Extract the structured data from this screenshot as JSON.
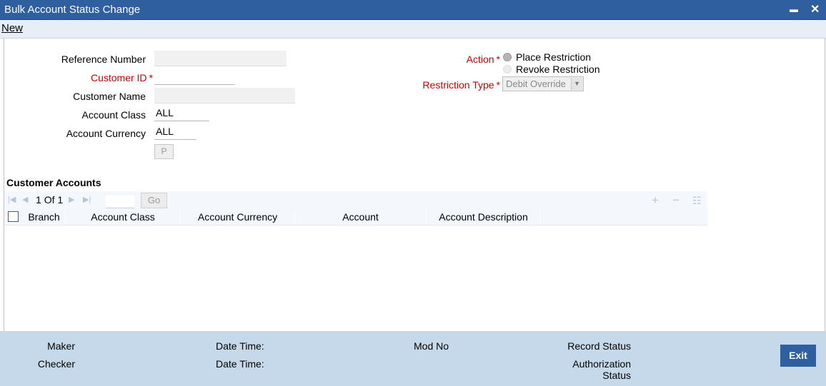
{
  "window": {
    "title": "Bulk Account Status Change",
    "minimize": "▬",
    "close": "✕"
  },
  "menu": {
    "new": "New"
  },
  "form": {
    "reference_number_label": "Reference Number",
    "reference_number_value": "",
    "customer_id_label": "Customer ID",
    "customer_id_value": "",
    "customer_name_label": "Customer Name",
    "customer_name_value": "",
    "account_class_label": "Account Class",
    "account_class_value": "ALL",
    "account_currency_label": "Account Currency",
    "account_currency_value": "ALL",
    "populate_button": "P",
    "required_mark": "*",
    "action_label": "Action",
    "action_options": [
      "Place Restriction",
      "Revoke Restriction"
    ],
    "action_selected": "Place Restriction",
    "restriction_type_label": "Restriction Type",
    "restriction_type_value": "Debit Override"
  },
  "accounts": {
    "title": "Customer Accounts",
    "page_current": "1",
    "page_of": "Of",
    "page_total": "1",
    "go_button": "Go",
    "columns": [
      "Branch",
      "Account Class",
      "Account Currency",
      "Account",
      "Account Description"
    ],
    "rows": []
  },
  "footer": {
    "maker": "Maker",
    "checker": "Checker",
    "date_time_1": "Date Time:",
    "date_time_2": "Date Time:",
    "mod_no": "Mod No",
    "record_status": "Record Status",
    "authorization_status_1": "Authorization",
    "authorization_status_2": "Status",
    "exit_button": "Exit"
  },
  "colors": {
    "titlebar": "#2f5f9e",
    "required": "#cc0000",
    "footer": "#c6d9ea"
  }
}
